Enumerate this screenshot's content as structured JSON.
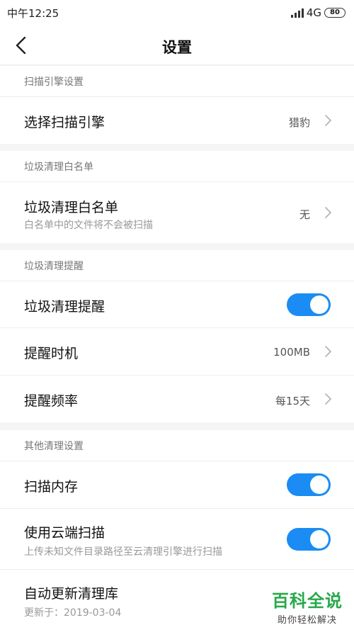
{
  "status_bar": {
    "time": "中午12:25",
    "network": "4G",
    "battery": "80"
  },
  "header": {
    "title": "设置"
  },
  "sections": [
    {
      "title": "扫描引擎设置",
      "rows": [
        {
          "title": "选择扫描引擎",
          "value": "猎豹"
        }
      ]
    },
    {
      "title": "垃圾清理白名单",
      "rows": [
        {
          "title": "垃圾清理白名单",
          "description": "白名单中的文件将不会被扫描",
          "value": "无"
        }
      ]
    },
    {
      "title": "垃圾清理提醒",
      "rows": [
        {
          "title": "垃圾清理提醒",
          "toggle_on": true
        },
        {
          "title": "提醒时机",
          "value": "100MB"
        },
        {
          "title": "提醒频率",
          "value": "每15天"
        }
      ]
    },
    {
      "title": "其他清理设置",
      "rows": [
        {
          "title": "扫描内存",
          "toggle_on": true
        },
        {
          "title": "使用云端扫描",
          "description": "上传未知文件目录路径至云清理引擎进行扫描",
          "toggle_on": true
        },
        {
          "title": "自动更新清理库",
          "description": "更新于：2019-03-04"
        }
      ]
    }
  ],
  "watermark": {
    "main": "百科全说",
    "sub": "助你轻松解决"
  },
  "colors": {
    "toggle_on": "#1a8cf3",
    "watermark": "#27a84a",
    "background": "#f5f5f5"
  }
}
